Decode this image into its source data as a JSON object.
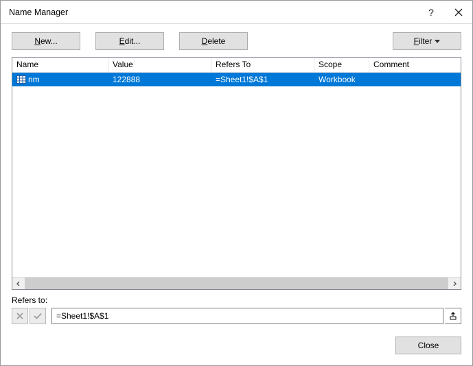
{
  "dialog": {
    "title": "Name Manager"
  },
  "toolbar": {
    "new_label": "New...",
    "edit_label": "Edit...",
    "delete_label": "Delete",
    "filter_label": "Filter"
  },
  "columns": {
    "name": "Name",
    "value": "Value",
    "refers_to": "Refers To",
    "scope": "Scope",
    "comment": "Comment"
  },
  "rows": [
    {
      "name": "nm",
      "value": "122888",
      "refers_to": "=Sheet1!$A$1",
      "scope": "Workbook",
      "comment": ""
    }
  ],
  "refers": {
    "label": "Refers to:",
    "value": "=Sheet1!$A$1"
  },
  "footer": {
    "close_label": "Close"
  }
}
